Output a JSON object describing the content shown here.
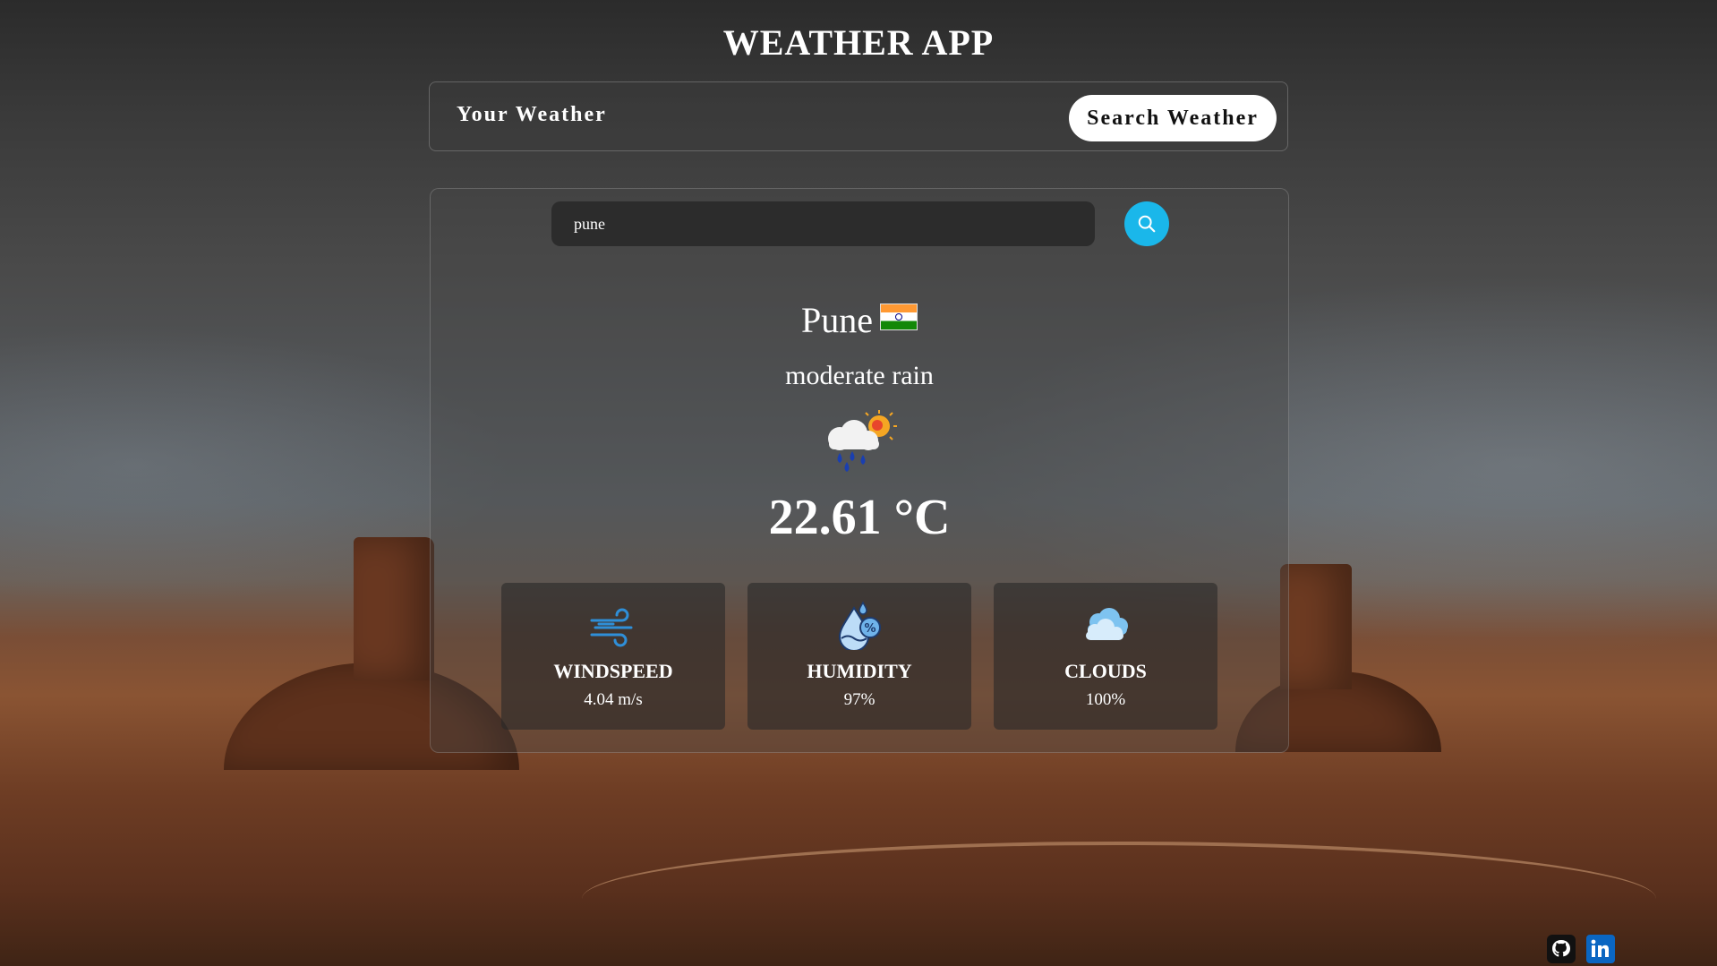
{
  "app": {
    "title": "WEATHER APP"
  },
  "tabs": {
    "your_weather": "Your Weather",
    "search_weather": "Search Weather"
  },
  "search": {
    "value": "pune",
    "placeholder": ""
  },
  "weather": {
    "city": "Pune",
    "country_flag": "india-flag",
    "description": "moderate rain",
    "icon": "rain-sun-cloud-icon",
    "temperature": "22.61 °C"
  },
  "stats": {
    "windspeed": {
      "label": "WINDSPEED",
      "value": "4.04 m/s",
      "icon": "wind-icon"
    },
    "humidity": {
      "label": "HUMIDITY",
      "value": "97%",
      "icon": "humidity-drop-icon"
    },
    "clouds": {
      "label": "CLOUDS",
      "value": "100%",
      "icon": "clouds-icon"
    }
  },
  "footer": {
    "links": [
      "github-icon",
      "linkedin-icon"
    ]
  },
  "colors": {
    "accent": "#1ab7ea",
    "linkedin": "#0a66c2"
  }
}
